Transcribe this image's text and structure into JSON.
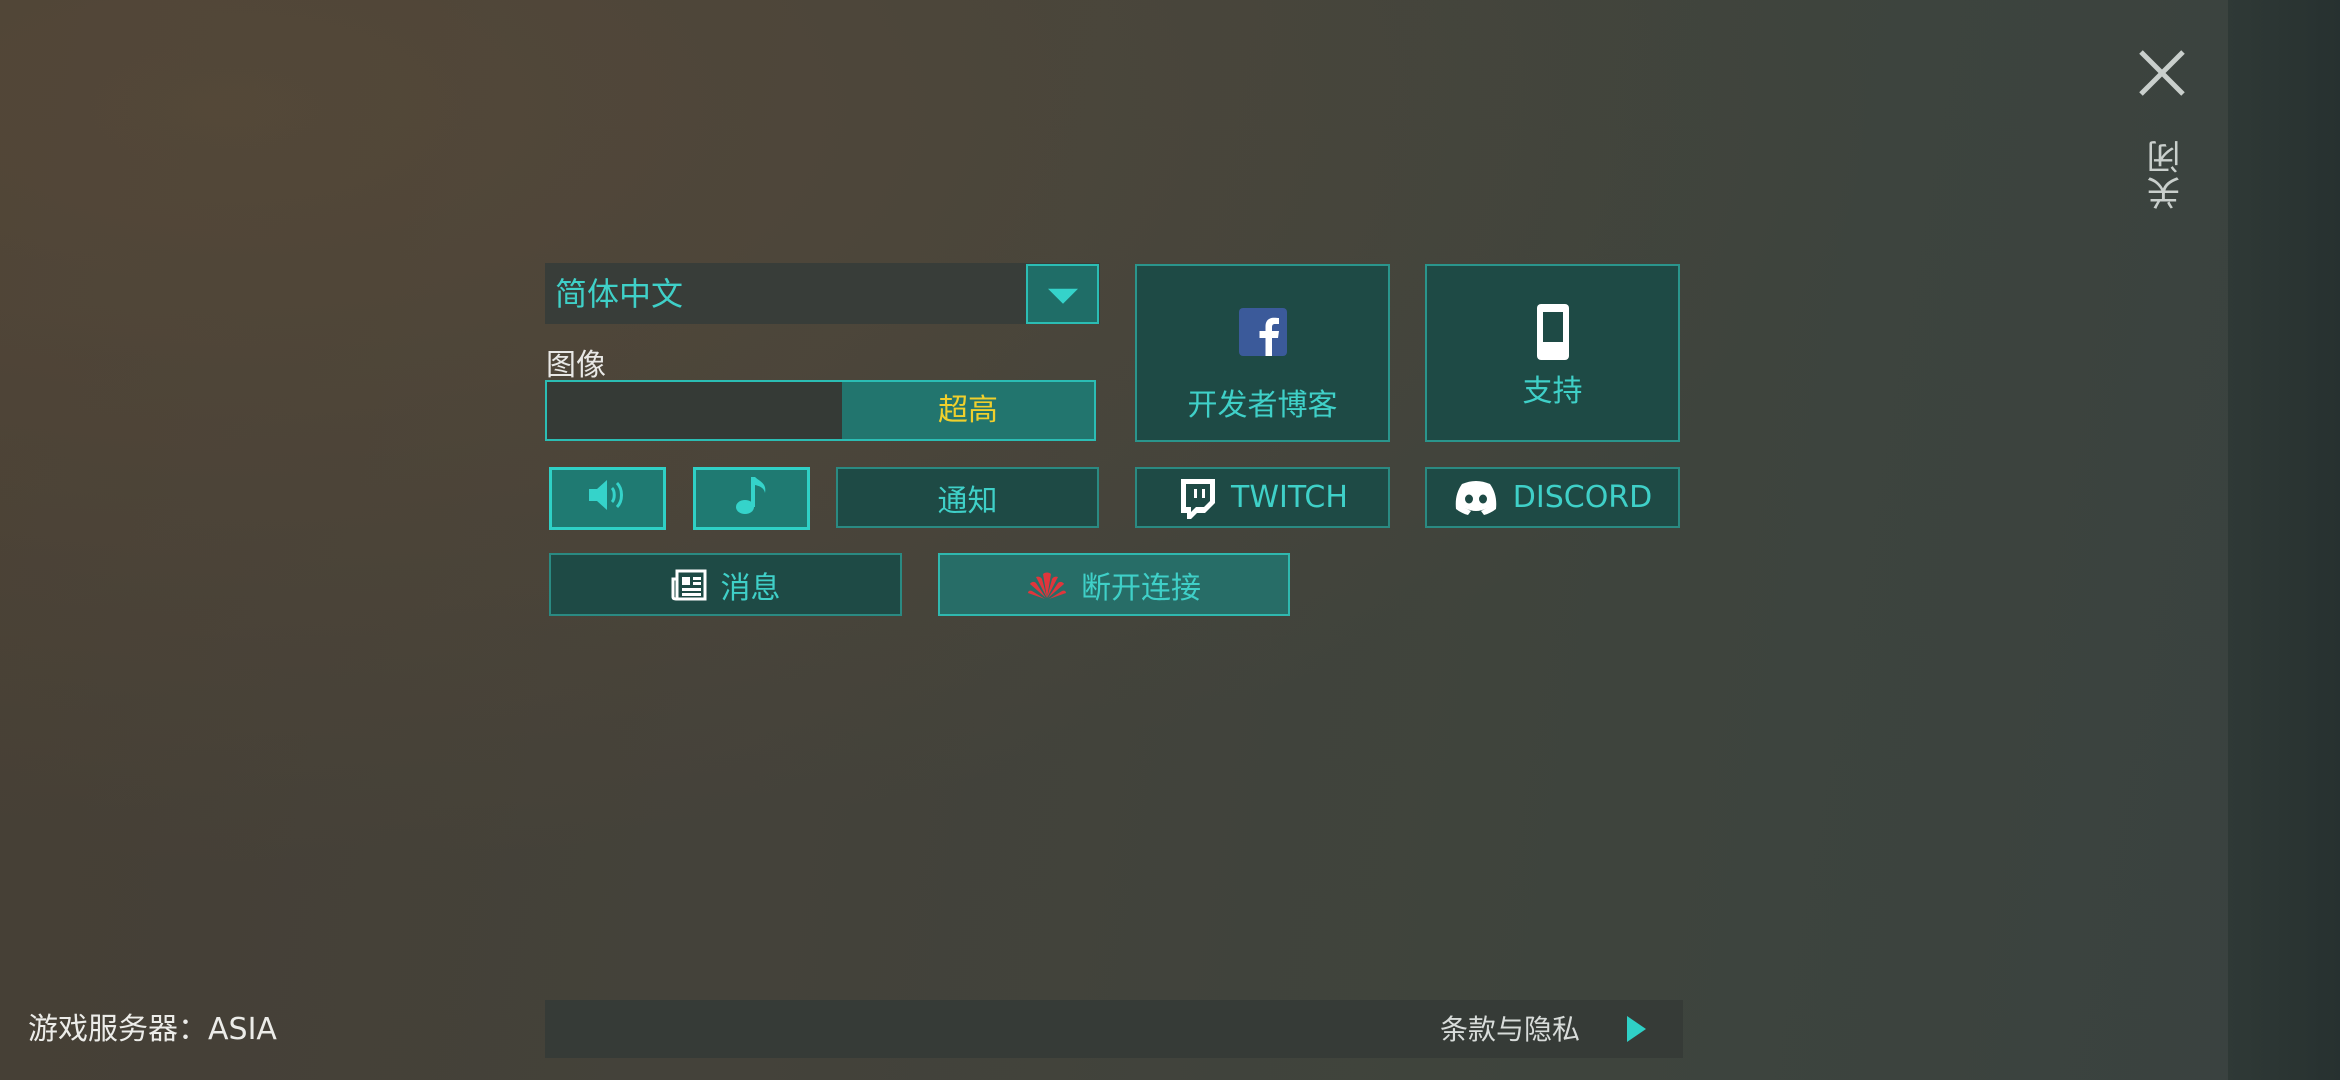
{
  "close": {
    "label": "关闭",
    "icon": "close-icon"
  },
  "language": {
    "selected": "简体中文",
    "icon": "chevron-down-icon"
  },
  "graphics": {
    "label": "图像",
    "value": "超高",
    "level_fraction": 0.46
  },
  "tiles": {
    "dev_blog": {
      "label": "开发者博客",
      "icon": "facebook-icon"
    },
    "support": {
      "label": "支持",
      "icon": "phone-icon"
    }
  },
  "buttons": {
    "sound": {
      "icon": "speaker-icon"
    },
    "music": {
      "icon": "music-note-icon"
    },
    "notifications": {
      "label": "通知"
    },
    "twitch": {
      "label": "TWITCH",
      "icon": "twitch-icon"
    },
    "discord": {
      "label": "DISCORD",
      "icon": "discord-icon"
    },
    "news": {
      "label": "消息",
      "icon": "newspaper-icon"
    },
    "disconnect": {
      "label": "断开连接",
      "icon": "huawei-icon"
    }
  },
  "footer": {
    "server": "游戏服务器：ASIA",
    "terms": "条款与隐私"
  },
  "colors": {
    "accent": "#2fd0c6",
    "button_dark": "#1e4a45",
    "button_lit": "#1f7a72",
    "graphics_value": "#f0d02c",
    "huawei_red": "#e0363c"
  }
}
